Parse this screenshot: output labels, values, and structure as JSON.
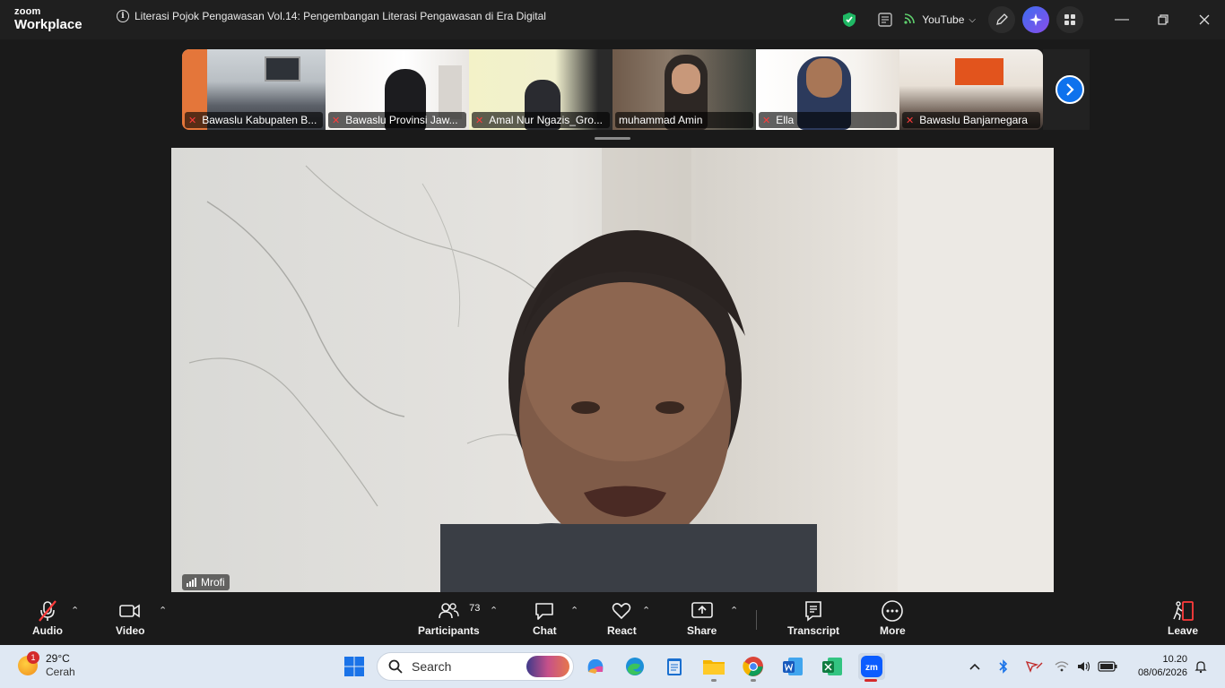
{
  "app": {
    "logo_line1": "zoom",
    "logo_line2": "Workplace"
  },
  "meeting": {
    "title": "Literasi Pojok Pengawasan Vol.14:  Pengembangan Literasi Pengawasan di Era Digital"
  },
  "titlebar": {
    "stream_label": "YouTube"
  },
  "participants_strip": [
    {
      "name": "Bawaslu Kabupaten B...",
      "muted": true
    },
    {
      "name": "Bawaslu Provinsi Jaw...",
      "muted": true
    },
    {
      "name": "Amal Nur Ngazis_Gro...",
      "muted": true
    },
    {
      "name": "muhammad Amin",
      "muted": false
    },
    {
      "name": "Ella",
      "muted": true
    },
    {
      "name": "Bawaslu Banjarnegara",
      "muted": true
    }
  ],
  "main_speaker": {
    "name": "Mrofi"
  },
  "toolbar": {
    "audio": "Audio",
    "video": "Video",
    "participants": "Participants",
    "participants_count": "73",
    "chat": "Chat",
    "react": "React",
    "share": "Share",
    "transcript": "Transcript",
    "more": "More",
    "leave": "Leave"
  },
  "taskbar": {
    "weather_temp": "29°C",
    "weather_desc": "Cerah",
    "weather_badge": "1",
    "search_placeholder": "Search",
    "time": "10.20",
    "date": "08/06/2026"
  },
  "colors": {
    "accent": "#0e72ed",
    "muted_red": "#ff3b3b",
    "shield_green": "#1fb864"
  }
}
